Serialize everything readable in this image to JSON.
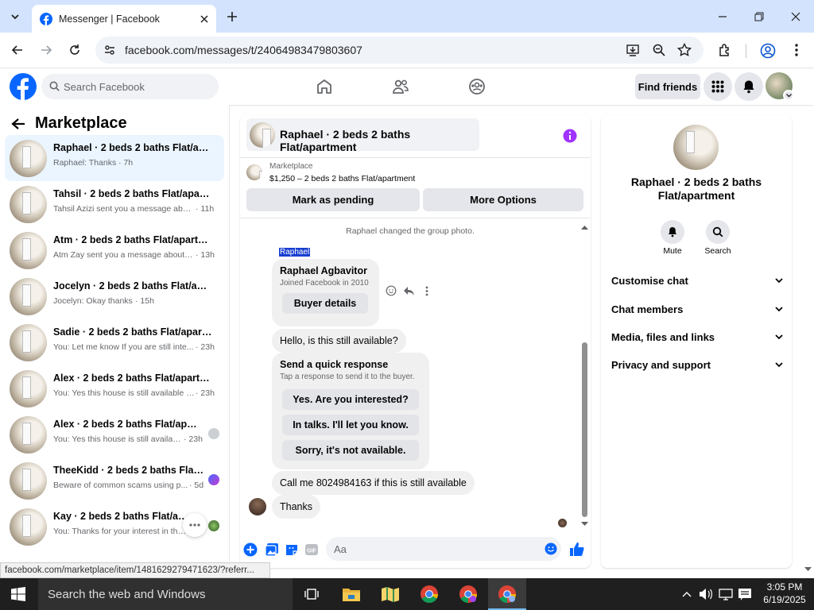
{
  "browser": {
    "tab_title": "Messenger | Facebook",
    "url": "facebook.com/messages/t/24064983479803607",
    "status_url": "facebook.com/marketplace/item/1481629279471623/?referr..."
  },
  "fb_header": {
    "search_placeholder": "Search Facebook",
    "find_friends": "Find friends"
  },
  "sidebar": {
    "title": "Marketplace",
    "conversations": [
      {
        "name": "Raphael · 2 beds 2 baths Flat/apar...",
        "preview": "Raphael: Thanks",
        "time": "· 7h",
        "selected": true
      },
      {
        "name": "Tahsil · 2 beds 2 baths Flat/apartm...",
        "preview": "Tahsil Azizi sent you a message abou...",
        "time": "· 11h"
      },
      {
        "name": "Atm · 2 beds 2 baths Flat/apartment",
        "preview": "Atm Zay sent you a message about y...",
        "time": "· 13h"
      },
      {
        "name": "Jocelyn · 2 beds 2 baths Flat/apart...",
        "preview": "Jocelyn: Okay thanks",
        "time": "· 15h"
      },
      {
        "name": "Sadie · 2 beds 2 baths Flat/apartm...",
        "preview": "You: Let me know If you are still inte...",
        "time": "· 23h"
      },
      {
        "name": "Alex · 2 beds 2 baths Flat/apartment",
        "preview": "You: Yes this house is still available fo...",
        "time": "· 23h"
      },
      {
        "name": "Alex · 2 beds 2 baths Flat/apart...",
        "preview": "You: Yes this house is still availabl...",
        "time": "· 23h"
      },
      {
        "name": "TheeKidd · 2 beds 2 baths Flat/a...",
        "preview": "Beware of common scams using p...",
        "time": "· 5d"
      },
      {
        "name": "Kay · 2 beds 2 baths Flat/apart...",
        "preview": "You: Thanks for your interest in the...",
        "time": ""
      }
    ]
  },
  "chat": {
    "title": "Raphael · 2 beds 2 baths Flat/apartment",
    "listing_source": "Marketplace",
    "listing_text": "$1,250 – 2 beds 2 baths Flat/apartment",
    "mark_pending": "Mark as pending",
    "more_options": "More Options",
    "system_msg": "Raphael changed the group photo.",
    "sender_label": "Raphael",
    "profile_name": "Raphael Agbavitor",
    "profile_sub": "Joined Facebook in 2010",
    "buyer_details": "Buyer details",
    "msg1": "Hello, is this still available?",
    "quick_title": "Send a quick response",
    "quick_sub": "Tap a response to send it to the buyer.",
    "quick_replies": [
      "Yes. Are you interested?",
      "In talks. I'll let you know.",
      "Sorry, it's not available."
    ],
    "msg2": "Call me 8024984163 if this is still available",
    "msg3": "Thanks",
    "compose_placeholder": "Aa"
  },
  "info_panel": {
    "title": "Raphael · 2 beds 2 baths Flat/apartment",
    "mute": "Mute",
    "search": "Search",
    "rows": [
      "Customise chat",
      "Chat members",
      "Media, files and links",
      "Privacy and support"
    ]
  },
  "taskbar": {
    "search_placeholder": "Search the web and Windows",
    "time": "3:05 PM",
    "date": "6/19/2025"
  },
  "colors": {
    "fb_blue": "#0866ff",
    "messenger_purple": "#a033ff",
    "selected_bg": "#ebf5ff"
  }
}
